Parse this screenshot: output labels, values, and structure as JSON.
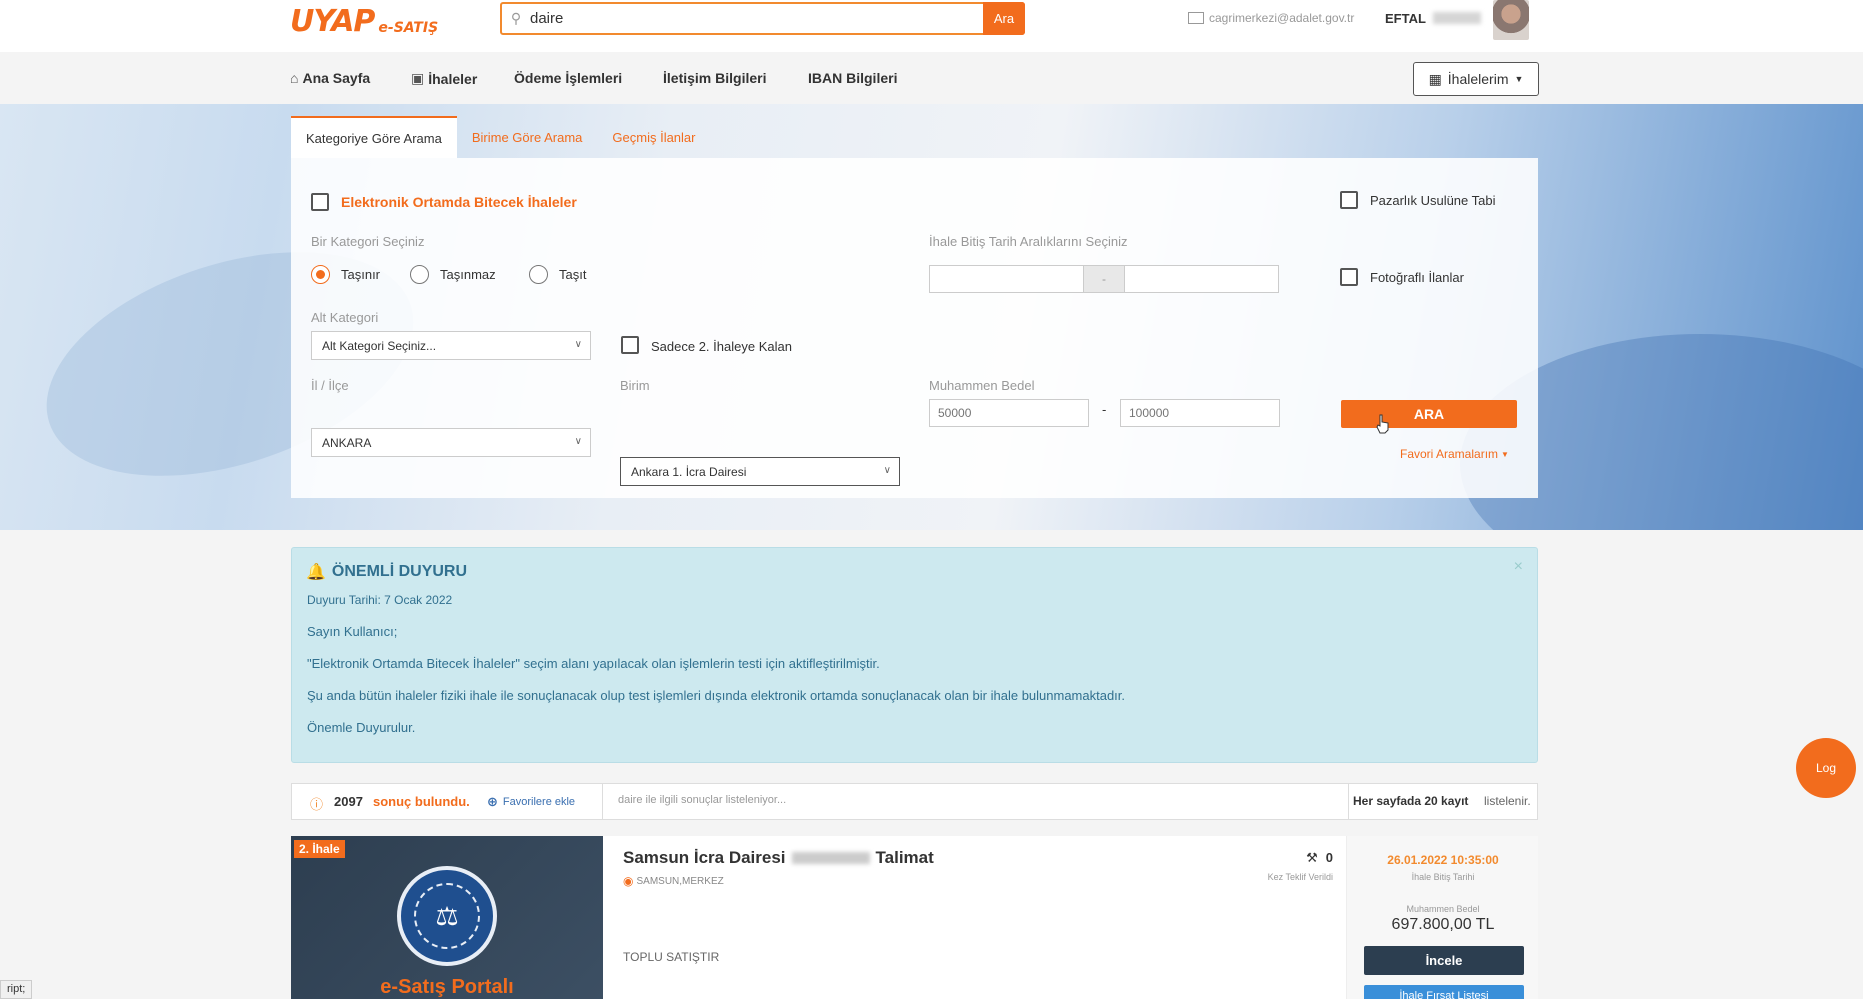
{
  "header": {
    "logo_main": "UYAP",
    "logo_sub": "e-SATIŞ",
    "search_value": "daire",
    "search_button": "Ara",
    "email": "cagrimerkezi@adalet.gov.tr",
    "user_name": "EFTAL"
  },
  "nav": {
    "items": [
      "Ana Sayfa",
      "İhaleler",
      "Ödeme İşlemleri",
      "İletişim Bilgileri",
      "IBAN Bilgileri"
    ],
    "my_bids": "İhalelerim"
  },
  "search_tabs": [
    "Kategoriye Göre Arama",
    "Birime Göre Arama",
    "Geçmiş İlanlar"
  ],
  "filters": {
    "electronic_label": "Elektronik Ortamda Bitecek İhaleler",
    "bargain_label": "Pazarlık Usulüne Tabi",
    "photo_label": "Fotoğraflı İlanlar",
    "category_label": "Bir Kategori Seçiniz",
    "categories": [
      "Taşınır",
      "Taşınmaz",
      "Taşıt"
    ],
    "date_range_label": "İhale Bitiş Tarih Aralıklarını Seçiniz",
    "date_sep": "-",
    "subcategory_label": "Alt Kategori",
    "subcategory_value": "Alt Kategori Seçiniz...",
    "second_only_label": "Sadece 2. İhaleye Kalan",
    "province_label": "İl / İlçe",
    "province_value": "ANKARA",
    "unit_label": "Birim",
    "unit_value": "Ankara 1. İcra Dairesi",
    "estimate_label": "Muhammen Bedel",
    "estimate_min_placeholder": "50000",
    "estimate_sep": "-",
    "estimate_max_placeholder": "100000",
    "search_button": "ARA",
    "favorites": "Favori Aramalarım"
  },
  "notice": {
    "title": "ÖNEMLİ DUYURU",
    "close": "×",
    "date": "Duyuru Tarihi: 7 Ocak 2022",
    "lines": [
      "Sayın Kullanıcı;",
      "\"Elektronik Ortamda Bitecek İhaleler\" seçim alanı yapılacak olan işlemlerin testi için aktifleştirilmiştir.",
      "Şu anda bütün ihaleler fiziki ihale ile sonuçlanacak olup test işlemleri dışında elektronik ortamda sonuçlanacak olan bir ihale bulunmamaktadır.",
      "Önemle Duyurulur."
    ]
  },
  "results": {
    "count": "2097",
    "found_text": "sonuç bulundu.",
    "add_favorites": "Favorilere ekle",
    "info_text": "daire ile ilgili sonuçlar listeleniyor...",
    "per_page_text": "Her sayfada 20 kayıt",
    "per_page_suffix": "listelenir."
  },
  "card": {
    "badge": "2. İhale",
    "portal_title": "e-Satış Portalı",
    "title_prefix": "Samsun İcra Dairesi",
    "title_suffix": "Talimat",
    "location": "SAMSUN,MERKEZ",
    "description": "TOPLU SATIŞTIR",
    "offer_count": "0",
    "offer_label": "Kez Teklif Verildi",
    "end_date": "26.01.2022 10:35:00",
    "end_date_label": "İhale Bitiş Tarihi",
    "price_label": "Muhammen Bedel",
    "price": "697.800,00 TL",
    "inspect_button": "İncele",
    "list_button": "İhale Fırsat Listesi"
  },
  "floating": {
    "log_label": "Log"
  },
  "status_bar": "ript;"
}
